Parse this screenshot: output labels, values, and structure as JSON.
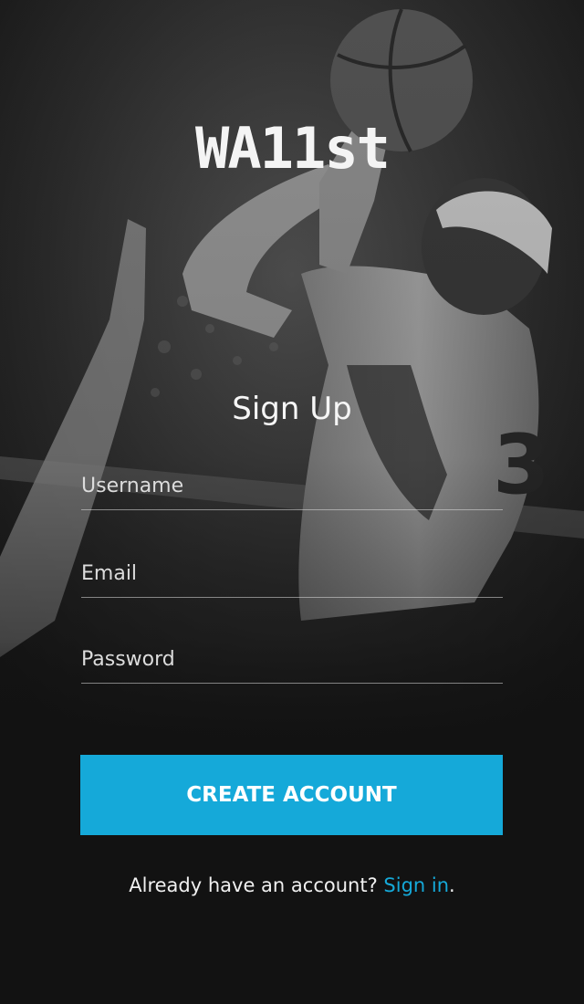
{
  "app": {
    "logo_text": "WA11st"
  },
  "form": {
    "title": "Sign Up",
    "username_placeholder": "Username",
    "email_placeholder": "Email",
    "password_placeholder": "Password",
    "submit_label": "CREATE ACCOUNT"
  },
  "footer": {
    "prompt_text": "Already have an account?",
    "sign_in_label": "Sign in",
    "trailing_punctuation": "."
  },
  "background": {
    "image_subject": "basketball player shooting, grayscale photo",
    "jersey_number": "3"
  },
  "colors": {
    "background": "#121212",
    "accent": "#15a9d9",
    "text": "#ffffff"
  }
}
